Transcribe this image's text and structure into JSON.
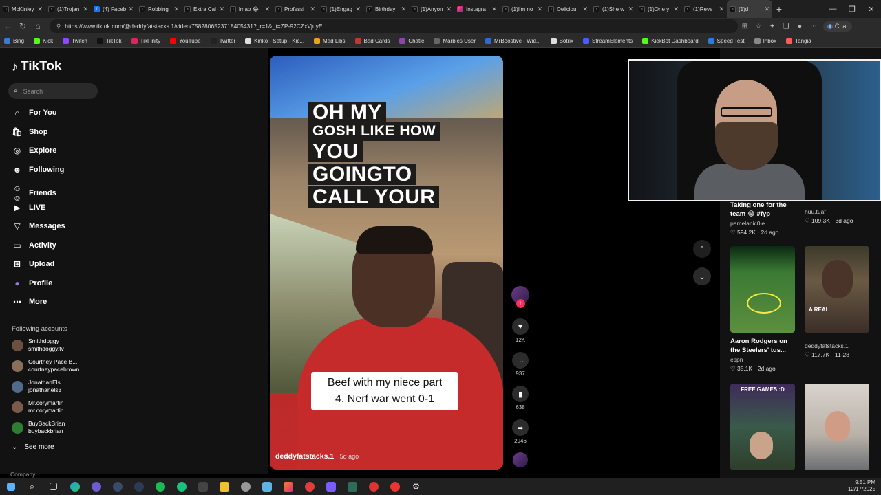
{
  "browser": {
    "tabs": [
      {
        "label": "McKinley",
        "icon": "tiktok"
      },
      {
        "label": "(1)Trojan",
        "icon": "tiktok"
      },
      {
        "label": "(4) Faceb",
        "icon": "facebook"
      },
      {
        "label": "Robbing",
        "icon": "tiktok"
      },
      {
        "label": "Extra Cal",
        "icon": "tiktok"
      },
      {
        "label": "lmao 😂",
        "icon": "tiktok"
      },
      {
        "label": "Professi",
        "icon": "tiktok"
      },
      {
        "label": "(1)Engag",
        "icon": "tiktok"
      },
      {
        "label": "Birthday",
        "icon": "tiktok"
      },
      {
        "label": "(1)Anyon",
        "icon": "tiktok"
      },
      {
        "label": "Instagra",
        "icon": "instagram"
      },
      {
        "label": "(1)I'm no",
        "icon": "tiktok"
      },
      {
        "label": "Deliciou",
        "icon": "tiktok"
      },
      {
        "label": "(1)She w",
        "icon": "tiktok"
      },
      {
        "label": "(1)One y",
        "icon": "tiktok"
      },
      {
        "label": "(1)Reve",
        "icon": "tiktok"
      },
      {
        "label": "(1)d",
        "icon": "tiktok"
      }
    ],
    "url": "https://www.tiktok.com/@deddyfatstacks.1/video/7582806523718405431?_r=1&_t=ZP-92CZxVjuyE",
    "chat_label": "Chat",
    "bookmarks": [
      {
        "label": "Bing",
        "color": "#3a7bd5"
      },
      {
        "label": "Kick",
        "color": "#53fc18"
      },
      {
        "label": "Twitch",
        "color": "#9146ff"
      },
      {
        "label": "TikTok",
        "color": "#111111"
      },
      {
        "label": "TikFinity",
        "color": "#e0245e"
      },
      {
        "label": "YouTube",
        "color": "#ff0000"
      },
      {
        "label": "Twitter",
        "color": "#222222"
      },
      {
        "label": "Kinko - Setup - Kic...",
        "color": "#dddddd"
      },
      {
        "label": "Mad Libs",
        "color": "#e9a31b"
      },
      {
        "label": "Bad Cards",
        "color": "#c0392b"
      },
      {
        "label": "Chatle",
        "color": "#8e44ad"
      },
      {
        "label": "Marbles User",
        "color": "#666666"
      },
      {
        "label": "MrBoostive - Wid...",
        "color": "#2e6ad1"
      },
      {
        "label": "Botrix",
        "color": "#dddddd"
      },
      {
        "label": "StreamElements",
        "color": "#4a5cff"
      },
      {
        "label": "KickBot Dashboard",
        "color": "#53fc18"
      },
      {
        "label": "Speed Test",
        "color": "#2c7be5"
      },
      {
        "label": "Inbox",
        "color": "#888888"
      },
      {
        "label": "Tangia",
        "color": "#ff5a5a"
      }
    ]
  },
  "sidebar": {
    "logo": "TikTok",
    "search_placeholder": "Search",
    "nav": [
      {
        "label": "For You",
        "icon": "home"
      },
      {
        "label": "Shop",
        "icon": "shop"
      },
      {
        "label": "Explore",
        "icon": "compass"
      },
      {
        "label": "Following",
        "icon": "following"
      },
      {
        "label": "Friends",
        "icon": "friends"
      },
      {
        "label": "LIVE",
        "icon": "live"
      },
      {
        "label": "Messages",
        "icon": "messages"
      },
      {
        "label": "Activity",
        "icon": "activity"
      },
      {
        "label": "Upload",
        "icon": "upload"
      },
      {
        "label": "Profile",
        "icon": "profile"
      },
      {
        "label": "More",
        "icon": "more"
      }
    ],
    "following_title": "Following accounts",
    "accounts": [
      {
        "name": "Smithdoggy",
        "handle": "smithdoggy.tv"
      },
      {
        "name": "Courtney Pace B...",
        "handle": "courtneypacebrown"
      },
      {
        "name": "JonathanEls",
        "handle": "jonathanels3"
      },
      {
        "name": "Mr.corymartin",
        "handle": "mr.corymartin"
      },
      {
        "name": "BuyBackBrian",
        "handle": "buybackbrian"
      }
    ],
    "see_more": "See more",
    "company": "Company"
  },
  "video": {
    "caption_lines": [
      "OH MY",
      "GOSH LIKE HOW",
      "YOU",
      "GOINGTO",
      "CALL YOUR"
    ],
    "subtitle_line1": "Beef with my niece part",
    "subtitle_line2": "4. Nerf war went 0-1",
    "author": "deddyfatstacks.1",
    "posted": "· 5d ago"
  },
  "actions": {
    "likes": "12K",
    "comments": "937",
    "saves": "638",
    "shares": "2946"
  },
  "grid": {
    "cards": [
      {
        "title": "Taking one for the team 😂 #fyp",
        "user": "pamelanic0le",
        "meta": "♡ 594.2K · 2d ago"
      },
      {
        "title": "",
        "user": "huu.tuaf",
        "meta": "♡ 109.3K · 3d ago"
      },
      {
        "title": "Aaron Rodgers on the Steelers' tus...",
        "user": "espn",
        "meta": "♡ 35.1K · 2d ago"
      },
      {
        "title": "",
        "user": "deddyfatstacks.1",
        "meta": "♡ 117.7K · 11-28"
      },
      {
        "thumb_text": "FREE GAMES :D"
      },
      {
        "thumb_text": ""
      }
    ],
    "thumb_text_real": "A REAL"
  },
  "taskbar": {
    "time": "9:51 PM",
    "date": "12/17/2025"
  }
}
